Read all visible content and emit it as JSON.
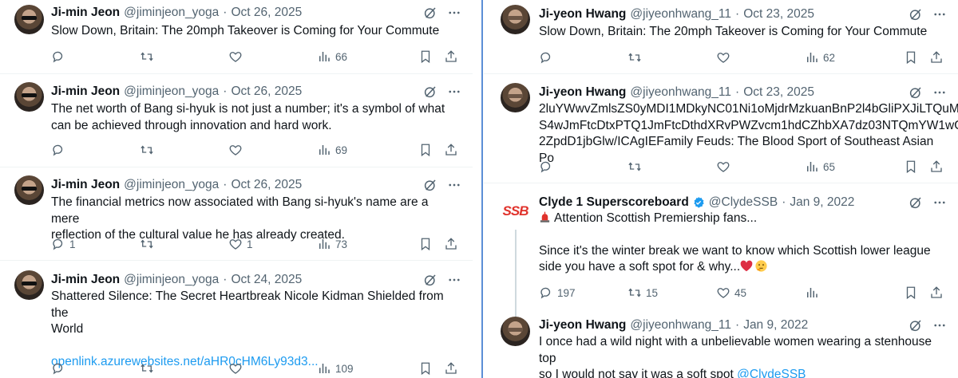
{
  "left_column": {
    "tweets": [
      {
        "author": "Ji-min Jeon",
        "handle": "@jiminjeon_yoga",
        "date": "Oct 26, 2025",
        "text_lines": [
          "Slow Down, Britain: The 20mph Takeover is Coming for Your Commute"
        ],
        "replies": "",
        "retweets": "",
        "likes": "",
        "views": "66"
      },
      {
        "author": "Ji-min Jeon",
        "handle": "@jiminjeon_yoga",
        "date": "Oct 26, 2025",
        "text_lines": [
          "The net worth of Bang si-hyuk is not just a number; it's a symbol of what",
          "can be achieved through innovation and hard work."
        ],
        "replies": "",
        "retweets": "",
        "likes": "",
        "views": "69"
      },
      {
        "author": "Ji-min Jeon",
        "handle": "@jiminjeon_yoga",
        "date": "Oct 26, 2025",
        "text_lines": [
          "The financial metrics now associated with Bang si-hyuk's name are a mere",
          "reflection of the cultural value he has already created."
        ],
        "replies": "1",
        "retweets": "",
        "likes": "1",
        "views": "73"
      },
      {
        "author": "Ji-min Jeon",
        "handle": "@jiminjeon_yoga",
        "date": "Oct 24, 2025",
        "text_lines": [
          "Shattered Silence: The Secret Heartbreak Nicole Kidman Shielded from the",
          "World"
        ],
        "link": "openlink.azurewebsites.net/aHR0cHM6Ly93d3...",
        "replies": "",
        "retweets": "",
        "likes": "",
        "views": "109"
      }
    ]
  },
  "right_column": {
    "tweets": [
      {
        "author": "Ji-yeon Hwang",
        "handle": "@jiyeonhwang_11",
        "date": "Oct 23, 2025",
        "text_lines": [
          "Slow Down, Britain: The 20mph Takeover is Coming for Your Commute"
        ],
        "replies": "",
        "retweets": "",
        "likes": "",
        "views": "62"
      },
      {
        "author": "Ji-yeon Hwang",
        "handle": "@jiyeonhwang_11",
        "date": "Oct 23, 2025",
        "text_lines": [
          "2luYWwvZmlsZS0yMDI1MDkyNC01Ni1oMjdrMzkuanBnP2l4bGliPXJiLTQuM",
          "S4wJmFtcDtxPTQ1JmFtcDthdXRvPWZvcm1hdCZhbXA7dz03NTQmYW1wO",
          "2ZpdD1jbGlw/ICAgIEFamily Feuds: The Blood Sport of Southeast Asian Po"
        ],
        "replies": "",
        "retweets": "",
        "likes": "",
        "views": "65"
      },
      {
        "author": "Clyde 1 Superscoreboard",
        "handle": "@ClydeSSB",
        "date": "Jan 9, 2022",
        "logo_text": "SSB",
        "line1": "Attention Scottish Premiership fans...",
        "line2": "Since it's the winter break we want to know which Scottish lower league",
        "line3": "side you have a soft spot for & why...",
        "replies": "197",
        "retweets": "15",
        "likes": "45",
        "views": ""
      },
      {
        "author": "Ji-yeon Hwang",
        "handle": "@jiyeonhwang_11",
        "date": "Jan 9, 2022",
        "line1": "I once had a wild night with a unbelievable women wearing a stenhouse top",
        "line2": "so I would not say it was a soft spot",
        "mention": "@ClydeSSB"
      }
    ]
  },
  "icons": {
    "reply": "reply-icon",
    "retweet": "retweet-icon",
    "like": "heart-icon",
    "views": "views-icon",
    "bookmark": "bookmark-icon",
    "share": "share-icon",
    "grok": "grok-icon",
    "more": "more-icon",
    "verified": "verified-badge-icon",
    "siren": "siren-emoji",
    "heart_emoji": "red-heart-emoji",
    "thinking_emoji": "thinking-face-emoji"
  },
  "colors": {
    "link": "#1d9bf0",
    "muted": "#536471",
    "text": "#0f1419",
    "divider": "#5b8fd6"
  }
}
